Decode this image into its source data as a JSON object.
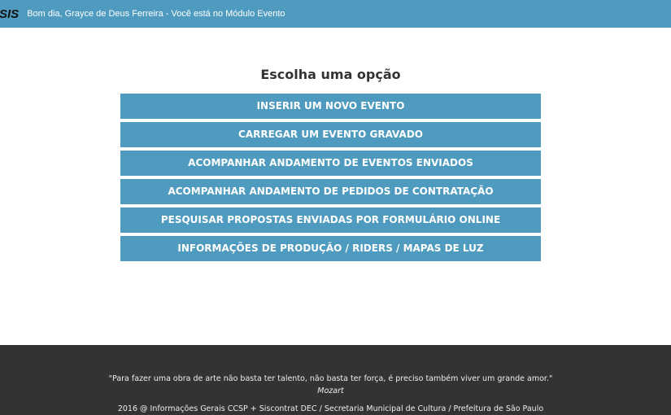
{
  "header": {
    "logo": "SIS",
    "greeting": "Bom dia, Grayce de Deus Ferreira - Você está no Módulo Evento",
    "bar_color": "#4f9bbf"
  },
  "main": {
    "title": "Escolha uma opção",
    "options": [
      {
        "label": "INSERIR UM NOVO EVENTO"
      },
      {
        "label": "CARREGAR UM EVENTO GRAVADO"
      },
      {
        "label": "ACOMPANHAR ANDAMENTO DE EVENTOS ENVIADOS"
      },
      {
        "label": "ACOMPANHAR ANDAMENTO DE PEDIDOS DE CONTRATAÇÃO"
      },
      {
        "label": "PESQUISAR PROPOSTAS ENVIADAS POR FORMULÁRIO ONLINE"
      },
      {
        "label": "INFORMAÇÕES DE PRODUÇÃO / RIDERS / MAPAS DE LUZ"
      }
    ]
  },
  "footer": {
    "quote": "\"Para fazer uma obra de arte não basta ter talento, não basta ter força, é preciso também viver um grande amor.\"",
    "author": "Mozart",
    "credits": "2016 @ Informações Gerais CCSP + Siscontrat DEC / Secretaria Municipal de Cultura / Prefeitura de São Paulo",
    "background": "#333333"
  }
}
